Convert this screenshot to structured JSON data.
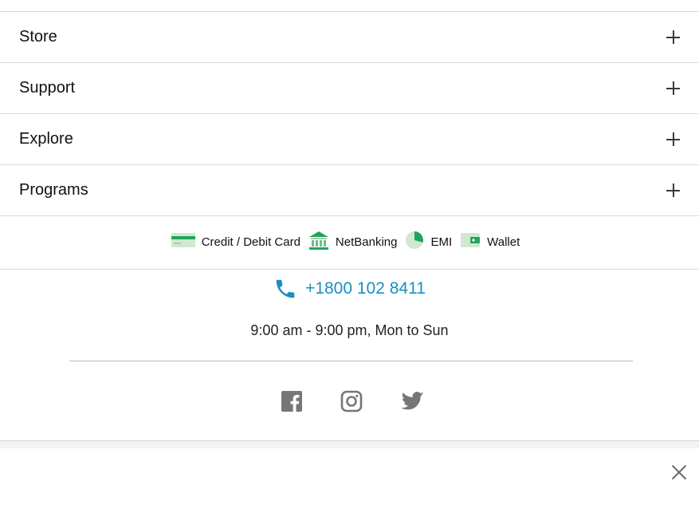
{
  "accordion": {
    "items": [
      {
        "label": "Store"
      },
      {
        "label": "Support"
      },
      {
        "label": "Explore"
      },
      {
        "label": "Programs"
      }
    ]
  },
  "payments": {
    "methods": [
      {
        "label": "Credit / Debit Card",
        "icon": "card-icon"
      },
      {
        "label": "NetBanking",
        "icon": "bank-icon"
      },
      {
        "label": "EMI",
        "icon": "pie-icon"
      },
      {
        "label": "Wallet",
        "icon": "wallet-icon"
      }
    ],
    "icon_color": "#22a35b"
  },
  "contact": {
    "phone": "+1800 102 8411",
    "phone_color": "#1a8fc1",
    "hours": "9:00 am - 9:00 pm, Mon to Sun"
  },
  "social": {
    "icons": [
      "facebook-icon",
      "instagram-icon",
      "twitter-icon"
    ],
    "icon_color": "#767676"
  },
  "overlay": {
    "close_icon": "close-icon"
  }
}
